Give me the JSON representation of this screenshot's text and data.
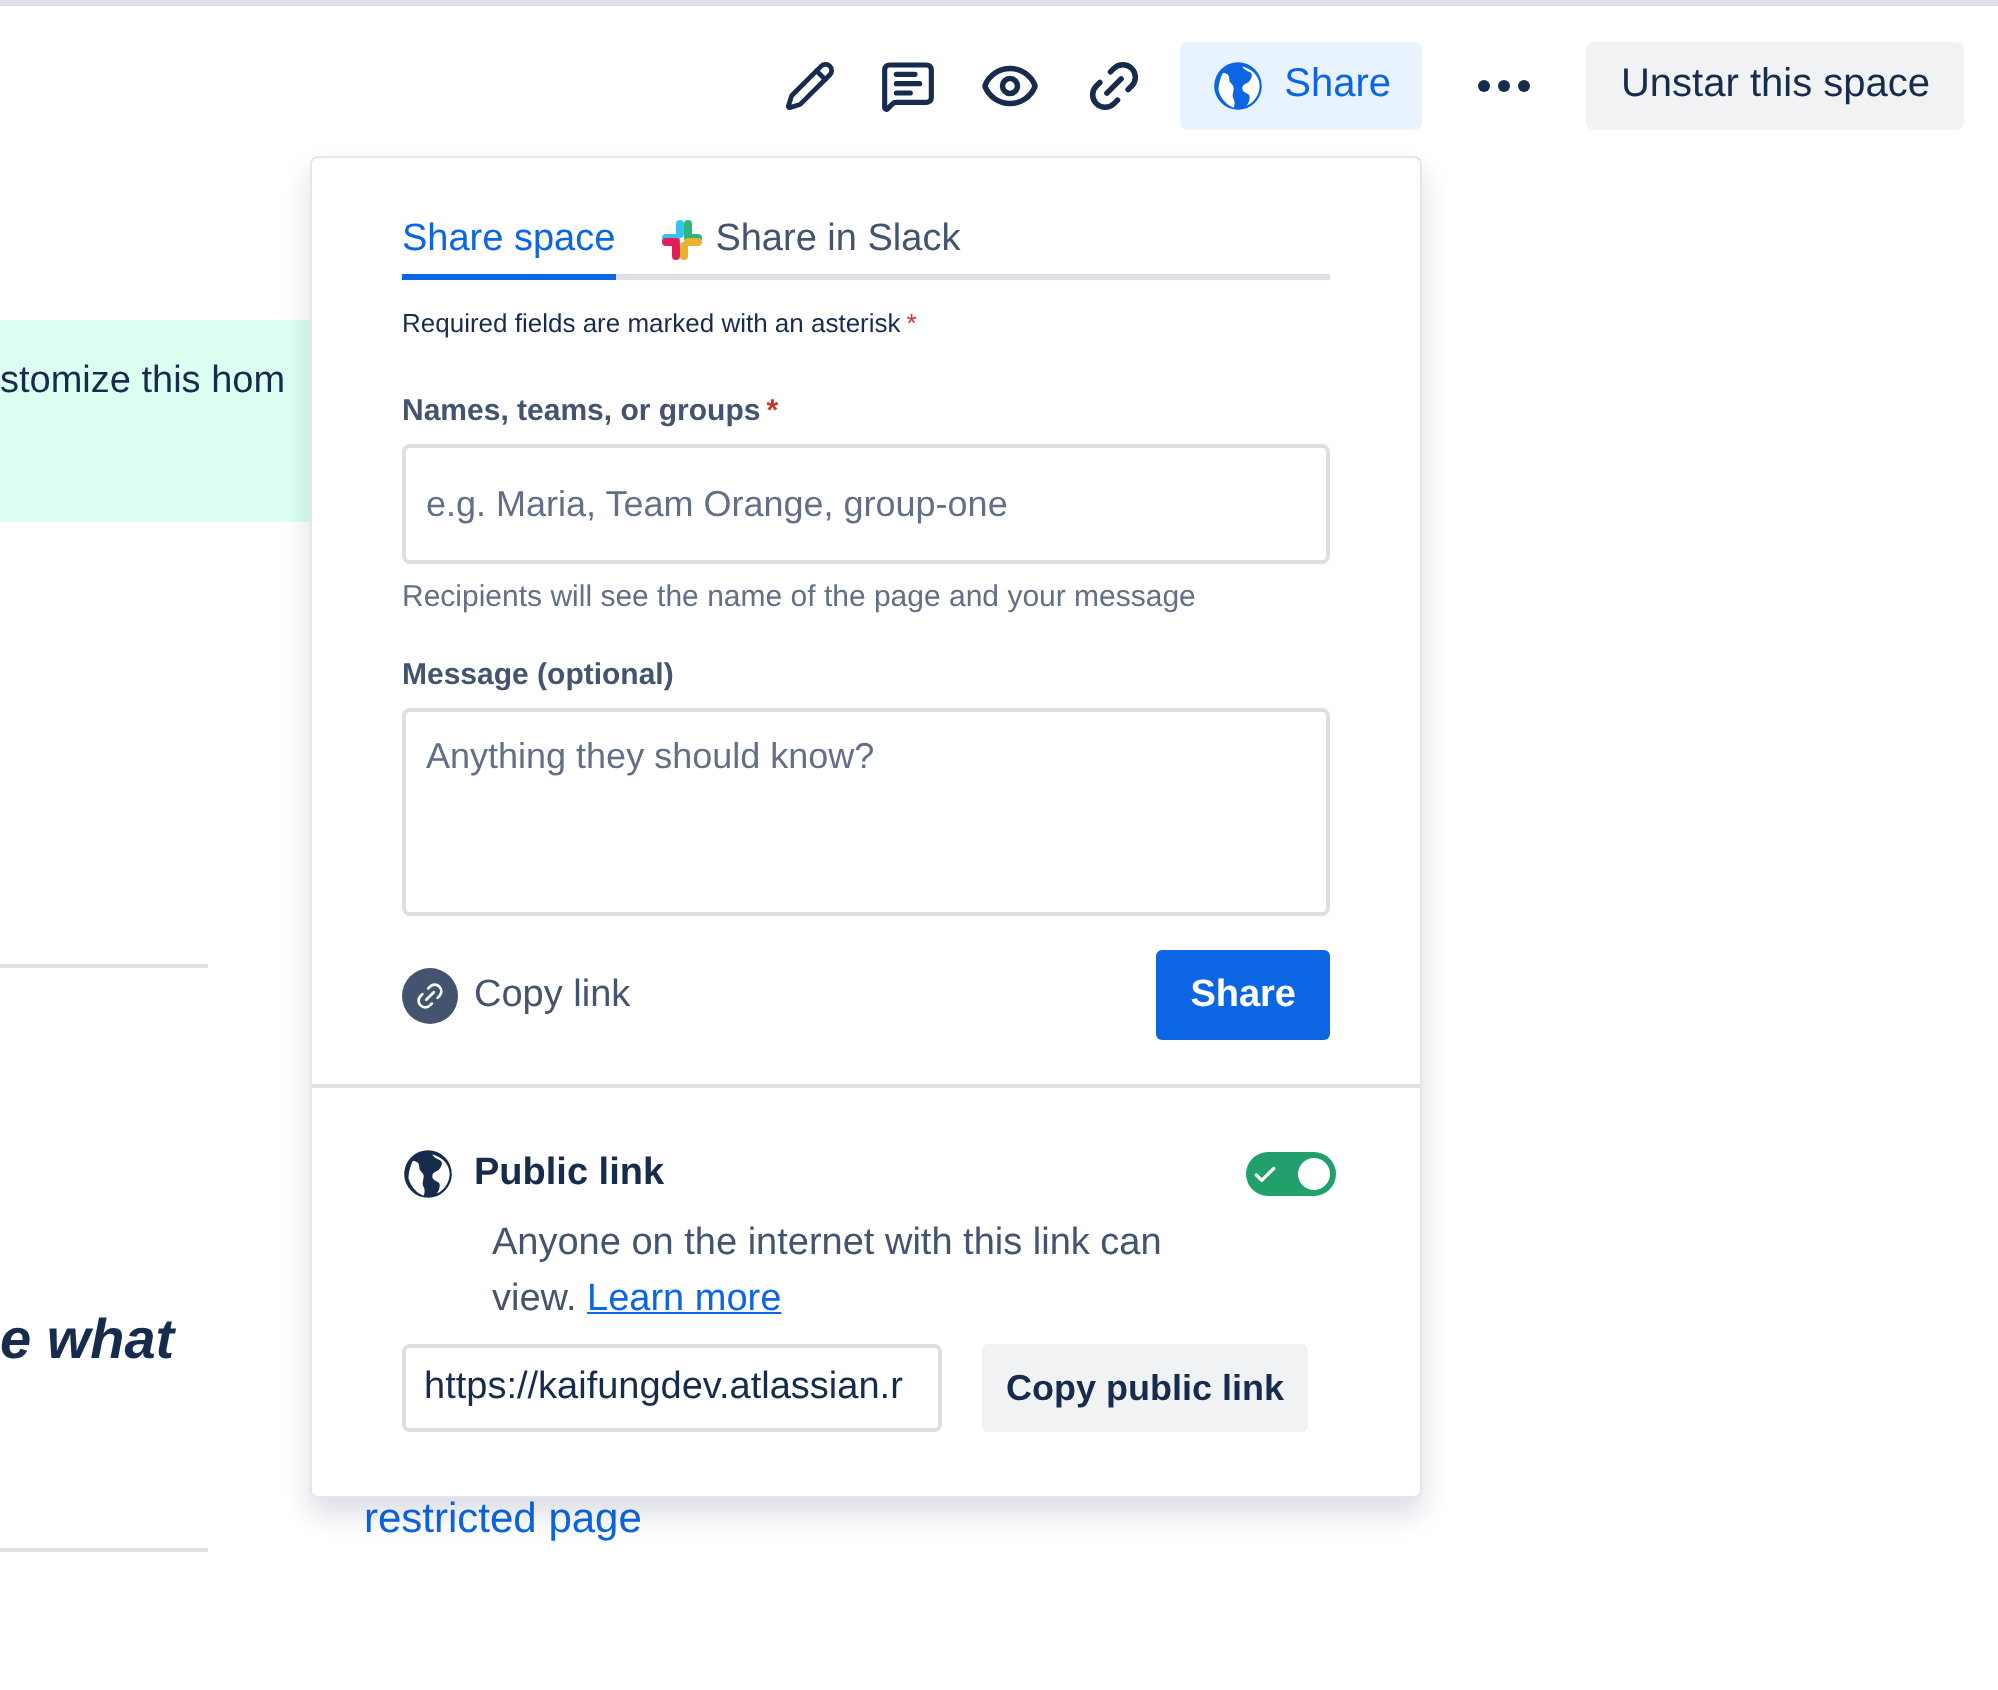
{
  "toolbar": {
    "share_button": "Share",
    "unstar_button": "Unstar this space"
  },
  "background": {
    "banner_text": "stomize this hom",
    "heading_fragment": "e what",
    "link": "restricted page"
  },
  "share_dialog": {
    "tabs": [
      {
        "label": "Share space",
        "selected": true,
        "kind": "plain"
      },
      {
        "label": "Share in Slack",
        "selected": false,
        "kind": "slack"
      }
    ],
    "required_note": "Required fields are marked with an asterisk",
    "asterisk": "*",
    "names_label": "Names, teams, or groups",
    "names_placeholder": "e.g. Maria, Team Orange, group-one",
    "names_help": "Recipients will see the name of the page and your message",
    "message_label": "Message (optional)",
    "message_placeholder": "Anything they should know?",
    "copy_link": "Copy link",
    "share_button": "Share",
    "public_link": {
      "title": "Public link",
      "on": true,
      "description": "Anyone on the internet with this link can view.",
      "learn_more": "Learn more",
      "url": "https://kaifungdev.atlassian.r",
      "copy_button": "Copy public link"
    }
  }
}
